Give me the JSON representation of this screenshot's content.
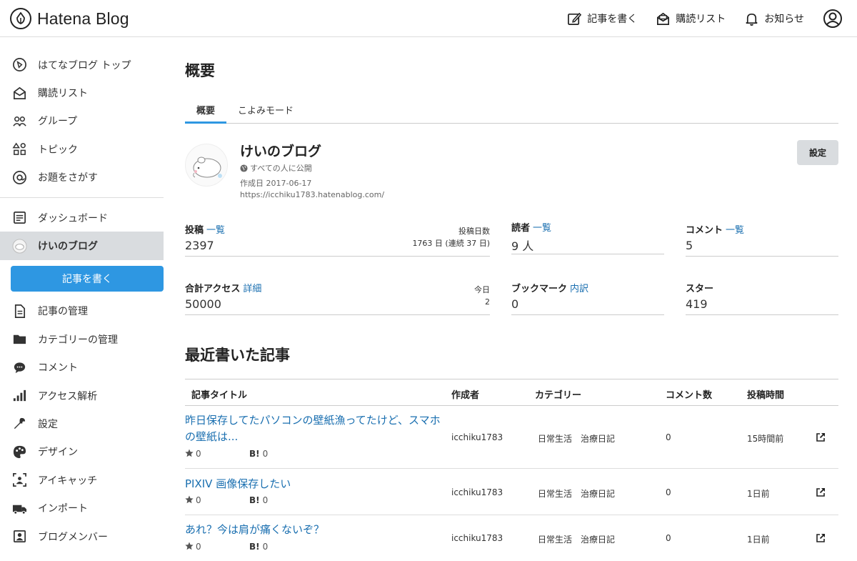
{
  "header": {
    "logo_text": "Hatena Blog",
    "nav": [
      {
        "label": "記事を書く",
        "icon": "edit-icon"
      },
      {
        "label": "購読リスト",
        "icon": "subscribe-icon"
      },
      {
        "label": "お知らせ",
        "icon": "bell-icon"
      }
    ],
    "account_icon": "user-icon"
  },
  "sidebar": {
    "top_items": [
      {
        "label": "はてなブログ トップ",
        "icon": "hatena-icon"
      },
      {
        "label": "購読リスト",
        "icon": "subscribe-icon"
      },
      {
        "label": "グループ",
        "icon": "group-icon"
      },
      {
        "label": "トピック",
        "icon": "topic-icon"
      },
      {
        "label": "お題をさがす",
        "icon": "at-icon"
      }
    ],
    "dashboard_label": "ダッシュボード",
    "blog_label": "けいのブログ",
    "write_button": "記事を書く",
    "bottom_items": [
      {
        "label": "記事の管理",
        "icon": "document-icon"
      },
      {
        "label": "カテゴリーの管理",
        "icon": "folder-icon"
      },
      {
        "label": "コメント",
        "icon": "comment-icon"
      },
      {
        "label": "アクセス解析",
        "icon": "bar-chart-icon"
      },
      {
        "label": "設定",
        "icon": "wrench-icon"
      },
      {
        "label": "デザイン",
        "icon": "palette-icon"
      },
      {
        "label": "アイキャッチ",
        "icon": "image-icon"
      },
      {
        "label": "インポート",
        "icon": "truck-icon"
      },
      {
        "label": "ブログメンバー",
        "icon": "members-icon"
      }
    ]
  },
  "main": {
    "title": "概要",
    "tabs": [
      "概要",
      "こよみモード"
    ],
    "blog": {
      "name": "けいのブログ",
      "visibility": "すべての人に公開",
      "created": "作成日 2017-06-17",
      "url": "https://icchiku1783.hatenablog.com/",
      "settings_button": "設定"
    },
    "stats": {
      "posts": {
        "label": "投稿",
        "link": "一覧",
        "value": "2397",
        "side_label": "投稿日数",
        "side_value": "1763 日 (連続 37 日)"
      },
      "readers": {
        "label": "読者",
        "link": "一覧",
        "value": "9 人"
      },
      "comments": {
        "label": "コメント",
        "link": "一覧",
        "value": "5"
      },
      "access": {
        "label": "合計アクセス",
        "link": "詳細",
        "value": "50000",
        "side_label": "今日",
        "side_value": "2"
      },
      "bookmarks": {
        "label": "ブックマーク",
        "link": "内訳",
        "value": "0"
      },
      "stars": {
        "label": "スター",
        "value": "419"
      }
    },
    "recent_title": "最近書いた記事",
    "table": {
      "headers": [
        "記事タイトル",
        "作成者",
        "カテゴリー",
        "コメント数",
        "投稿時間"
      ],
      "rows": [
        {
          "title": "昨日保存してたパソコンの壁紙漁ってたけど、スマホの壁紙は...",
          "stars": "0",
          "bookmarks": "0",
          "author": "icchiku1783",
          "categories": "日常生活　治療日記",
          "comments": "0",
          "time": "15時間前"
        },
        {
          "title": "PIXIV 画像保存したい",
          "stars": "0",
          "bookmarks": "0",
          "author": "icchiku1783",
          "categories": "日常生活　治療日記",
          "comments": "0",
          "time": "1日前"
        },
        {
          "title": "あれ？今は肩が痛くないぞ？",
          "stars": "0",
          "bookmarks": "0",
          "author": "icchiku1783",
          "categories": "日常生活　治療日記",
          "comments": "0",
          "time": "1日前"
        }
      ],
      "bookmark_mark": "B!"
    }
  }
}
